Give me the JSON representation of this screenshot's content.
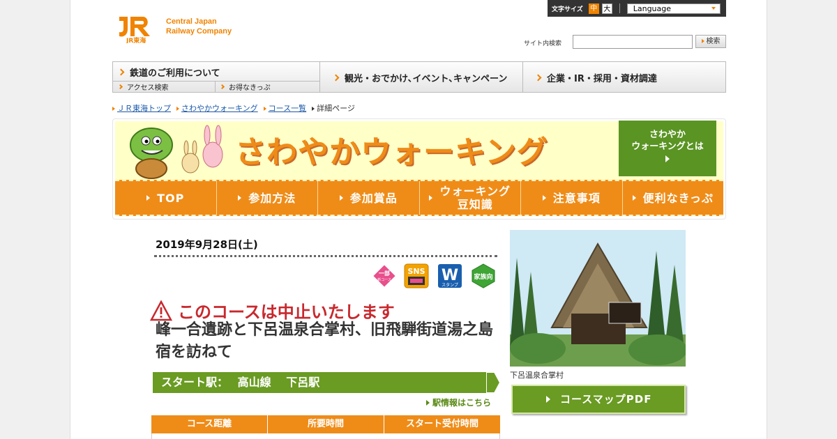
{
  "header": {
    "logo_text": "JR東海",
    "company_line1": "Central Japan",
    "company_line2": "Railway Company",
    "font_size_label": "文字サイズ",
    "font_size_mid": "中",
    "font_size_big": "大",
    "language_label": "Language",
    "search_label": "サイト内検索",
    "search_value": "",
    "search_button": "検索"
  },
  "nav": {
    "item1": "鉄道のご利用について",
    "item1_sub1": "アクセス検索",
    "item1_sub2": "お得なきっぷ",
    "item2": "観光・おでかけ､イベント､キャンペーン",
    "item3": "企業・IR・採用・資材調達"
  },
  "breadcrumb": {
    "item1": "ＪＲ東海トップ",
    "item2": "さわやかウォーキング",
    "item3": "コース一覧",
    "current": "詳細ページ"
  },
  "banner": {
    "title": "さわやかウォーキング",
    "about_line1": "さわやか",
    "about_line2": "ウォーキングとは",
    "menu": {
      "top": "TOP",
      "join": "参加方法",
      "prize": "参加賞品",
      "knowledge_line1": "ウォーキング",
      "knowledge_line2": "豆知識",
      "notes": "注意事項",
      "tickets": "便利なきっぷ"
    }
  },
  "event": {
    "date": "2019年9月28日(土)",
    "badges": {
      "partial_line1": "一部",
      "partial_line2": "新コース",
      "sns": "SNS",
      "w_letter": "W",
      "w_label": "スタンプ",
      "family": "家族向"
    },
    "cancel_notice": "このコースは中止いたします",
    "title": "峰一合遺跡と下呂温泉合掌村、旧飛騨街道湯之島宿を訪ねて",
    "start_label": "スタート駅：",
    "start_line": "高山線",
    "start_station": "下呂駅",
    "station_link": "駅情報はこちら",
    "table_headers": {
      "distance": "コース距離",
      "time": "所要時間",
      "reception": "スタート受付時間"
    }
  },
  "side": {
    "photo_caption": "下呂温泉合掌村",
    "pdf_button": "コースマップPDF"
  },
  "colors": {
    "brand_orange": "#f08300",
    "banner_orange": "#ef8c18",
    "green": "#6a9b22",
    "cancel_red": "#c8282d"
  }
}
